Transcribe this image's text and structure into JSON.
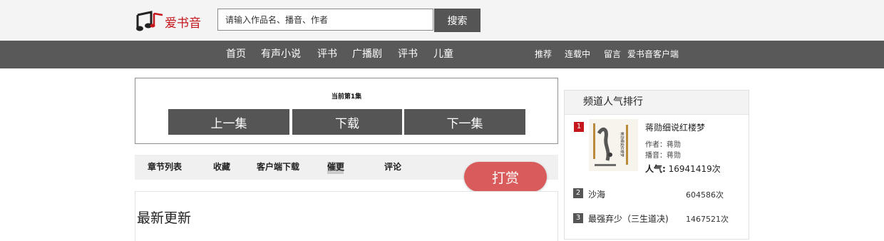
{
  "header": {
    "logo_text": "爱书音",
    "search": {
      "placeholder": "请输入作品名、播音、作者",
      "button_label": "搜索"
    }
  },
  "nav": {
    "main": [
      "首页",
      "有声小说",
      "评书",
      "广播剧",
      "评书",
      "儿童"
    ],
    "right": [
      "推荐",
      "连载中",
      "留言",
      "爱书音客户端"
    ]
  },
  "player": {
    "episode_label": "当前第1集",
    "prev_label": "上一集",
    "download_label": "下载",
    "next_label": "下一集"
  },
  "tabs": [
    "章节列表",
    "收藏",
    "客户端下载",
    "催更",
    "评论"
  ],
  "reward_label": "打赏",
  "latest": {
    "title": "最新更新"
  },
  "ranking": {
    "title": "频道人气排行",
    "top": {
      "rank": "1",
      "title": "蒋勋细说红楼梦",
      "author": "作者：蒋勋",
      "narrator": "播音：蒋勋",
      "popularity_label": "人气:",
      "popularity_value": "16941419次",
      "cover_text": "蒋勋细说红楼梦"
    },
    "items": [
      {
        "rank": "2",
        "title": "沙海",
        "count": "604586次"
      },
      {
        "rank": "3",
        "title": "最强弃少（三生道决)",
        "count": "1467521次"
      }
    ],
    "colors": {
      "rank1": "#c4161c",
      "rank_other": "#555555"
    }
  }
}
